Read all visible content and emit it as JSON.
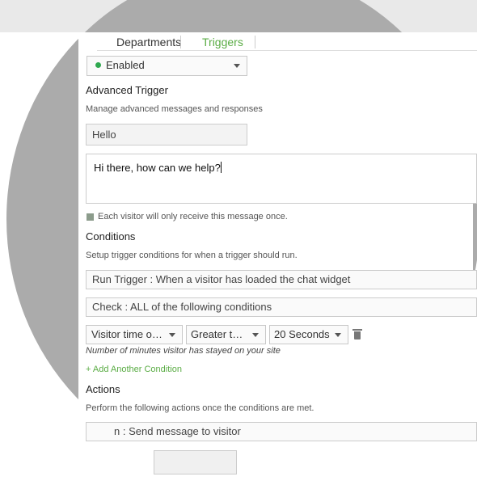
{
  "tabs": {
    "departments": "Departments",
    "triggers": "Triggers"
  },
  "status_select": {
    "value": "Enabled",
    "status_color": "#2fa84f"
  },
  "advanced": {
    "title": "Advanced Trigger",
    "description": "Manage advanced messages and responses",
    "name_value": "Hello",
    "message_value": "Hi there, how can we help?",
    "once_label": "Each visitor will only receive this message once."
  },
  "conditions": {
    "title": "Conditions",
    "description": "Setup trigger conditions for when a trigger should run.",
    "run_trigger": "Run Trigger : When a visitor has loaded the chat widget",
    "check": "Check : ALL of the following conditions",
    "row": {
      "field": "Visitor time o…",
      "operator": "Greater t…",
      "value": "20 Seconds",
      "hint": "Number of minutes visitor has stayed on your site"
    },
    "add_link": "+ Add Another Condition"
  },
  "actions": {
    "title": "Actions",
    "description": "Perform the following actions once the conditions are met.",
    "action_value": "n : Send message to visitor"
  },
  "colors": {
    "accent": "#5aac44",
    "status": "#2fa84f"
  }
}
